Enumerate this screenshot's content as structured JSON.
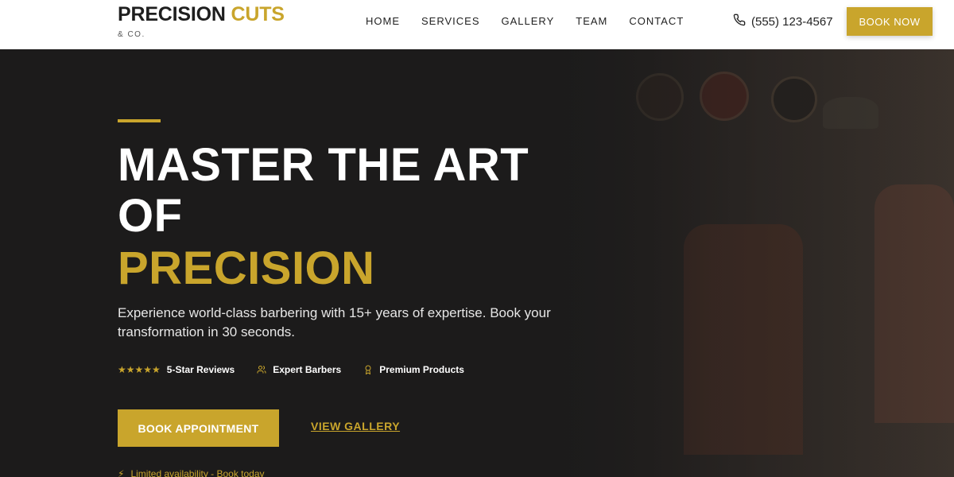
{
  "header": {
    "logo_main": "PRECISION",
    "logo_accent": "CUTS",
    "logo_sub": "& CO.",
    "nav": [
      "HOME",
      "SERVICES",
      "GALLERY",
      "TEAM",
      "CONTACT"
    ],
    "phone": "(555) 123-4567",
    "book_now": "BOOK NOW"
  },
  "hero": {
    "headline": "MASTER THE ART OF",
    "headline_gold": "PRECISION",
    "subtext": "Experience world-class barbering with 15+ years of expertise. Book your transformation in 30 seconds.",
    "badges": [
      {
        "label": "5-Star Reviews",
        "icon": "star-icon"
      },
      {
        "label": "Expert Barbers",
        "icon": "users-icon"
      },
      {
        "label": "Premium Products",
        "icon": "award-icon"
      }
    ],
    "book_appointment": "BOOK APPOINTMENT",
    "view_gallery": "VIEW GALLERY",
    "limited": "Limited availability - Book today"
  },
  "colors": {
    "accent": "#c9a52c",
    "dark": "#1c1b1b"
  }
}
